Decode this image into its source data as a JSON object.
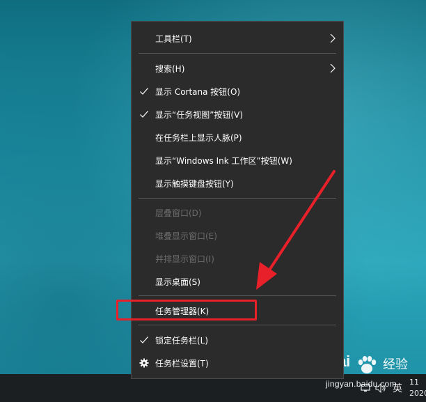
{
  "menu": {
    "items": [
      {
        "label": "工具栏(T)",
        "checked": false,
        "submenu": true,
        "disabled": false,
        "icon": ""
      },
      {
        "label": "搜索(H)",
        "checked": false,
        "submenu": true,
        "disabled": false,
        "icon": ""
      },
      {
        "label": "显示 Cortana 按钮(O)",
        "checked": true,
        "submenu": false,
        "disabled": false,
        "icon": "checkmark-icon"
      },
      {
        "label": "显示“任务视图”按钮(V)",
        "checked": true,
        "submenu": false,
        "disabled": false,
        "icon": "checkmark-icon"
      },
      {
        "label": "在任务栏上显示人脉(P)",
        "checked": false,
        "submenu": false,
        "disabled": false,
        "icon": ""
      },
      {
        "label": "显示“Windows Ink 工作区”按钮(W)",
        "checked": false,
        "submenu": false,
        "disabled": false,
        "icon": ""
      },
      {
        "label": "显示触摸键盘按钮(Y)",
        "checked": false,
        "submenu": false,
        "disabled": false,
        "icon": ""
      },
      {
        "label": "层叠窗口(D)",
        "checked": false,
        "submenu": false,
        "disabled": true,
        "icon": ""
      },
      {
        "label": "堆叠显示窗口(E)",
        "checked": false,
        "submenu": false,
        "disabled": true,
        "icon": ""
      },
      {
        "label": "并排显示窗口(I)",
        "checked": false,
        "submenu": false,
        "disabled": true,
        "icon": ""
      },
      {
        "label": "显示桌面(S)",
        "checked": false,
        "submenu": false,
        "disabled": false,
        "icon": ""
      },
      {
        "label": "任务管理器(K)",
        "checked": false,
        "submenu": false,
        "disabled": false,
        "icon": ""
      },
      {
        "label": "锁定任务栏(L)",
        "checked": true,
        "submenu": false,
        "disabled": false,
        "icon": "checkmark-icon"
      },
      {
        "label": "任务栏设置(T)",
        "checked": false,
        "submenu": false,
        "disabled": false,
        "icon": "gear-icon"
      }
    ]
  },
  "taskbar": {
    "ime_label": "英",
    "clock_time": "11",
    "clock_date": "2020",
    "tray_icons": [
      "network-icon",
      "volume-icon"
    ]
  },
  "watermark": {
    "logo_text": "Bai",
    "name_text": "经验",
    "url_text": "jingyan.baidu.com"
  },
  "colors": {
    "menu_bg": "#2b2b2b",
    "menu_text": "#ffffff",
    "disabled_text": "#6d6d6d",
    "annotation_red": "#e8202a",
    "taskbar_bg": "#1b1f22"
  }
}
